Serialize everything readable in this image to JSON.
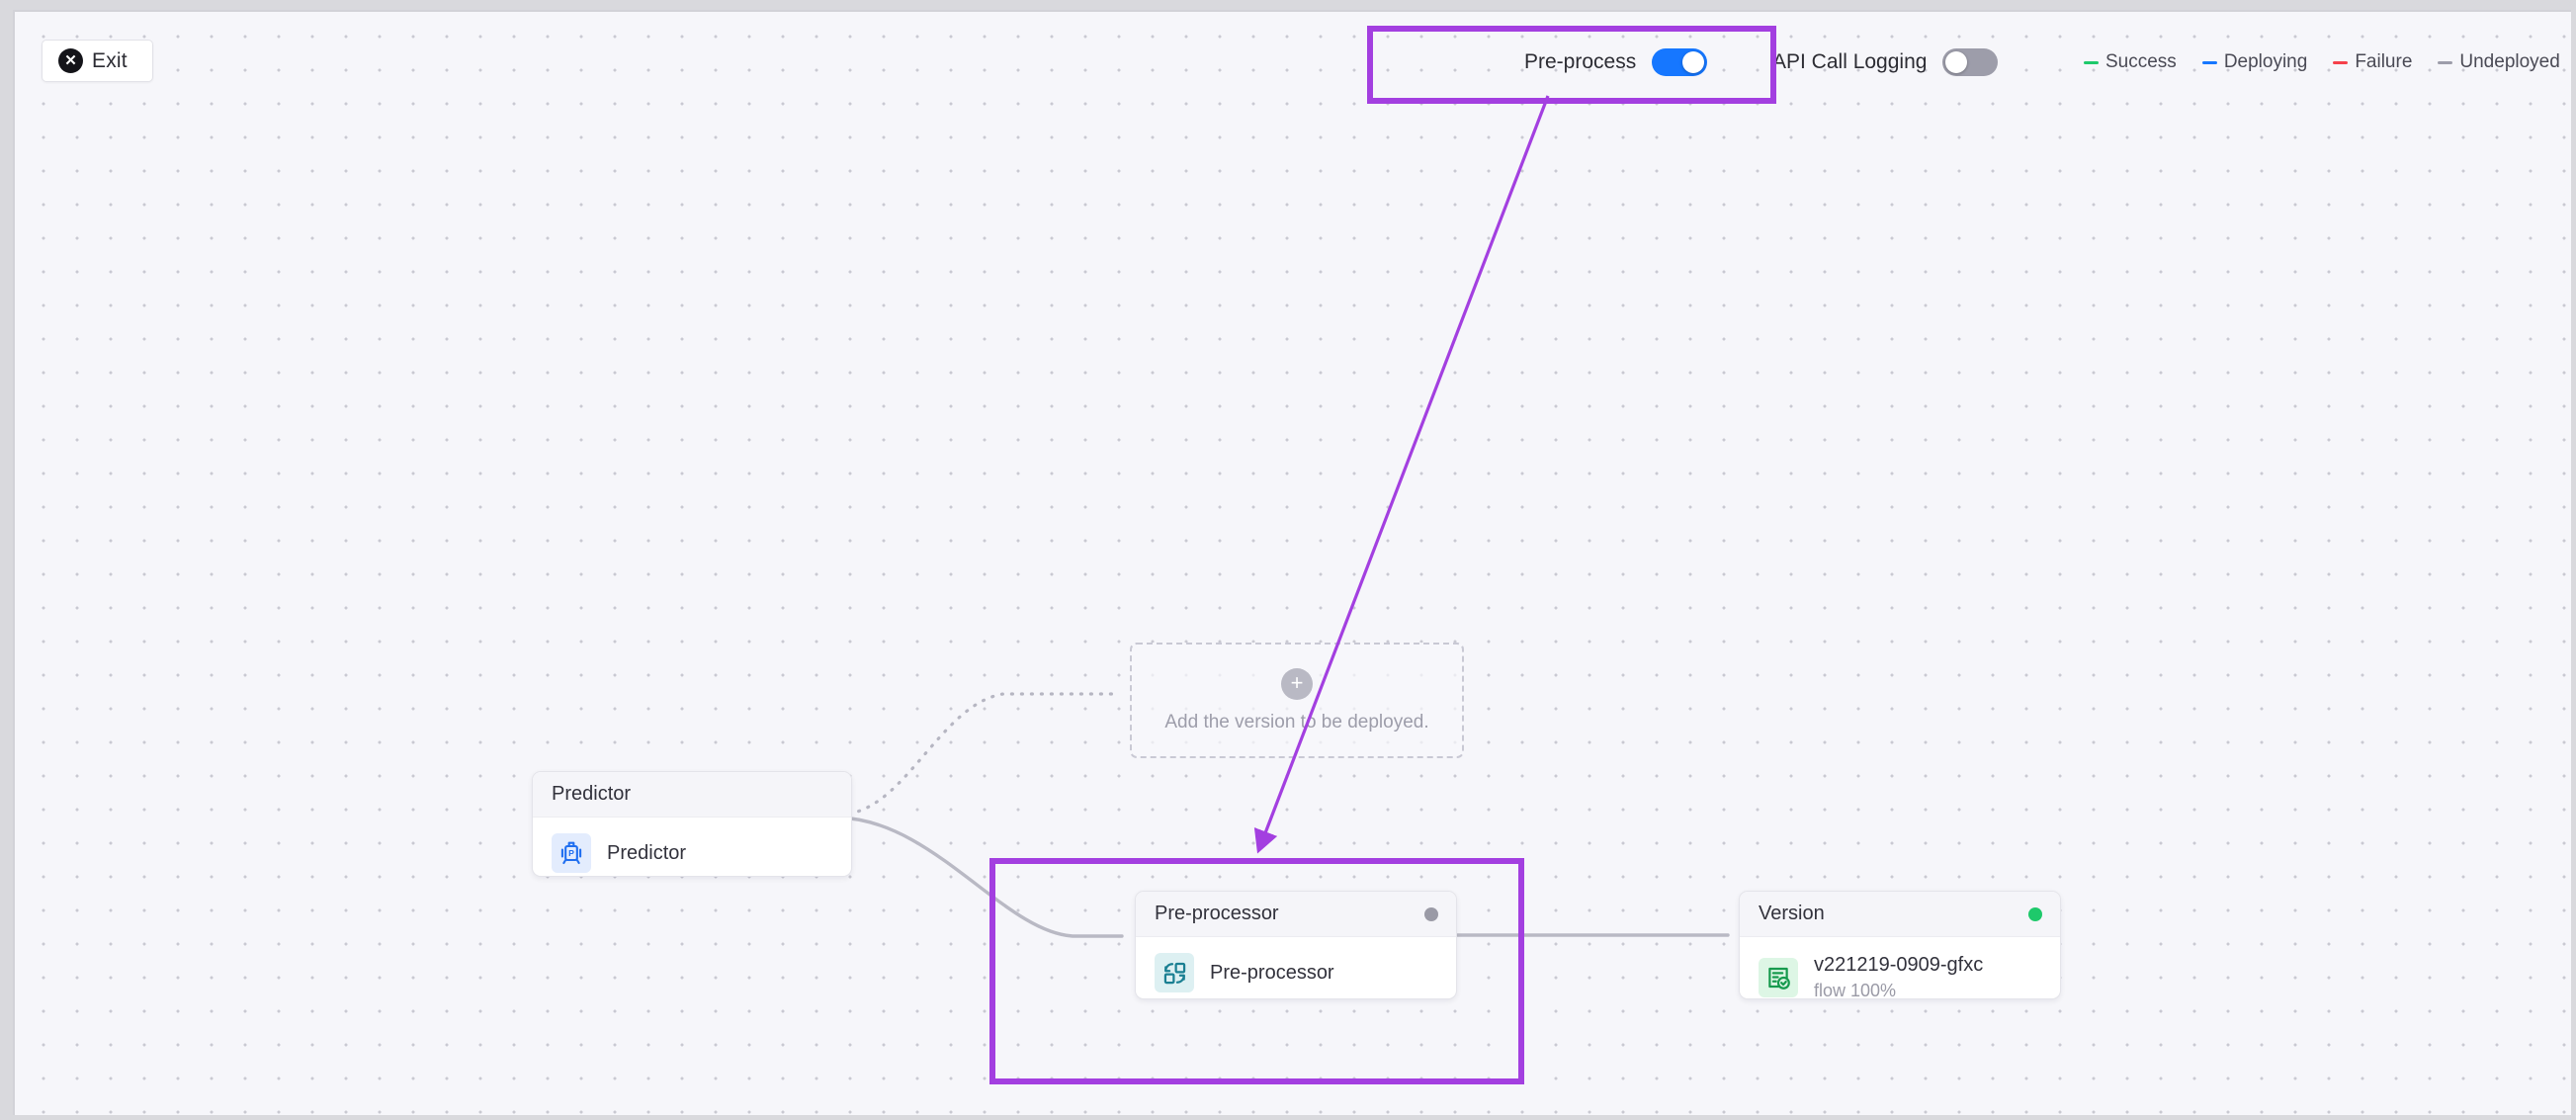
{
  "window": {
    "background": "#d9d9dd",
    "canvas_background": "#f6f6fa"
  },
  "toolbar": {
    "exit_label": "Exit",
    "exit_icon": "close-circle-icon"
  },
  "controls": [
    {
      "label": "Pre-process",
      "state": "on",
      "on_color": "#1677ff"
    },
    {
      "label": "API Call Logging",
      "state": "off",
      "off_color": "#9d9daa"
    }
  ],
  "legend": {
    "items": [
      {
        "label": "Success",
        "color": "#1ec96b"
      },
      {
        "label": "Deploying",
        "color": "#1677ff"
      },
      {
        "label": "Failure",
        "color": "#f5404a"
      },
      {
        "label": "Undeployed",
        "color": "#9d9daa"
      }
    ]
  },
  "placeholder": {
    "icon": "plus-circle-icon",
    "text": "Add the version to be deployed."
  },
  "nodes": [
    {
      "id": "predictor",
      "header_title": "Predictor",
      "status": null,
      "icon": "predictor-robot-icon",
      "icon_color": "#1f6ef0",
      "icon_bg": "#e3ecfd",
      "title": "Predictor",
      "subtitle": null
    },
    {
      "id": "preprocessor",
      "header_title": "Pre-processor",
      "status": "undeployed",
      "status_color": "#9a9aa6",
      "icon": "preprocessor-grid-icon",
      "icon_color": "#1a7f92",
      "icon_bg": "#ddf0f2",
      "title": "Pre-processor",
      "subtitle": null
    },
    {
      "id": "version",
      "header_title": "Version",
      "status": "success",
      "status_color": "#1ec96b",
      "icon": "version-checklist-icon",
      "icon_color": "#179a4e",
      "icon_bg": "#ddf6e5",
      "title": "v221219-0909-gfxc",
      "subtitle": "flow 100%"
    }
  ],
  "annotations": {
    "highlight_color": "#a33fe0",
    "boxes": [
      {
        "name": "pre-process-toggle-highlight"
      },
      {
        "name": "preprocessor-node-highlight"
      }
    ],
    "arrow": {
      "name": "annotation-arrow",
      "from": "pre-process-toggle",
      "to": "preprocessor-node"
    }
  }
}
